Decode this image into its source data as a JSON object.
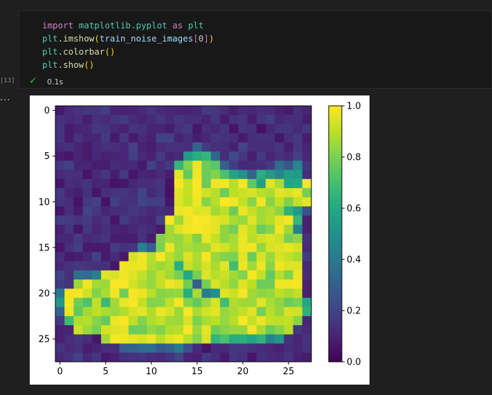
{
  "code_cell": {
    "execution_count": "[13]",
    "status_icon": "check-icon",
    "duration": "0.1s",
    "lines": [
      [
        {
          "t": "import",
          "c": "kw"
        },
        {
          "t": " "
        },
        {
          "t": "matplotlib.pyplot",
          "c": "mod"
        },
        {
          "t": " "
        },
        {
          "t": "as",
          "c": "kw"
        },
        {
          "t": " "
        },
        {
          "t": "plt",
          "c": "mod"
        }
      ],
      [
        {
          "t": "plt",
          "c": "mod"
        },
        {
          "t": "."
        },
        {
          "t": "imshow",
          "c": "fn"
        },
        {
          "t": "(",
          "c": "br1"
        },
        {
          "t": "train_noise_images",
          "c": "var"
        },
        {
          "t": "[",
          "c": "br2"
        },
        {
          "t": "0",
          "c": "num"
        },
        {
          "t": "]",
          "c": "br2"
        },
        {
          "t": ")",
          "c": "br1"
        }
      ],
      [
        {
          "t": "plt",
          "c": "mod"
        },
        {
          "t": "."
        },
        {
          "t": "colorbar",
          "c": "fn"
        },
        {
          "t": "()",
          "c": "br1"
        }
      ],
      [
        {
          "t": "plt",
          "c": "mod"
        },
        {
          "t": "."
        },
        {
          "t": "show",
          "c": "fn"
        },
        {
          "t": "()",
          "c": "br1"
        }
      ]
    ]
  },
  "output": {
    "ellipsis": "..."
  },
  "chart_data": {
    "type": "heatmap",
    "title": "",
    "xlabel": "",
    "ylabel": "",
    "x_ticks": [
      0,
      5,
      10,
      15,
      20,
      25
    ],
    "y_ticks": [
      0,
      5,
      10,
      15,
      20,
      25
    ],
    "xlim": [
      -0.5,
      27.5
    ],
    "ylim": [
      27.5,
      -0.5
    ],
    "colormap": "viridis",
    "colorbar": {
      "range": [
        0.0,
        1.0
      ],
      "ticks": [
        "0.0",
        "0.2",
        "0.4",
        "0.6",
        "0.8",
        "1.0"
      ]
    },
    "grid": false,
    "rows": [
      "0.07 0.12 0.14 0.16 0.15 0.18 0.10 0.09 0.10 0.12 0.15 0.12 0.11 0.10 0.09 0.11 0.17 0.16 0.13 0.08 0.12 0.11 0.13 0.12 0.09 0.07 0.13 0.10",
      "0.14 0.12 0.13 0.08 0.14 0.12 0.15 0.17 0.12 0.10 0.12 0.15 0.12 0.15 0.13 0.13 0.10 0.15 0.08 0.14 0.16 0.08 0.15 0.18 0.11 0.13 0.13 0.08",
      "0.15 0.07 0.10 0.11 0.16 0.15 0.11 0.09 0.15 0.14 0.10 0.10 0.08 0.14 0.17 0.06 0.13 0.11 0.15 0.05 0.15 0.14 0.04 0.11 0.15 0.15 0.12 0.16",
      "0.15 0.07 0.14 0.10 0.11 0.17 0.07 0.16 0.07 0.12 0.09 0.19 0.19 0.10 0.13 0.08 0.11 0.15 0.14 0.13 0.07 0.13 0.14 0.14 0.06 0.13 0.17 0.08",
      "0.12 0.14 0.10 0.07 0.12 0.14 0.13 0.11 0.19 0.09 0.08 0.12 0.14 0.14 0.13 0.32 0.17 0.13 0.13 0.09 0.20 0.13 0.13 0.13 0.15 0.08 0.16 0.10",
      "0.08 0.06 0.10 0.07 0.11 0.09 0.10 0.11 0.18 0.12 0.09 0.17 0.10 0.12 0.55 0.62 0.65 0.33 0.13 0.22 0.16 0.08 0.17 0.10 0.14 0.12 0.19 0.11",
      "0.16 0.19 0.10 0.10 0.08 0.08 0.13 0.11 0.12 0.07 0.19 0.12 0.17 0.66 0.81 0.97 0.77 0.74 0.30 0.18 0.11 0.12 0.13 0.17 0.35 0.27 0.45 0.15",
      "0.12 0.14 0.13 0.05 0.12 0.16 0.08 0.17 0.06 0.10 0.09 0.12 0.08 0.96 0.76 0.98 0.77 0.81 0.71 0.58 0.50 0.31 0.62 0.54 0.46 0.56 0.54 0.13",
      "0.06 0.13 0.12 0.15 0.10 0.10 0.05 0.06 0.11 0.13 0.13 0.15 0.05 0.99 0.91 1.00 0.77 0.98 0.99 0.89 0.99 0.75 0.56 0.95 0.87 0.59 0.60 0.99",
      "0.16 0.10 0.08 0.14 0.06 0.13 0.15 0.16 0.13 0.20 0.11 0.15 0.04 0.95 0.91 0.99 0.93 0.89 0.78 0.90 0.92 0.94 0.89 0.87 0.96 0.94 0.97 0.79",
      "0.15 0.13 0.05 0.17 0.19 0.05 0.19 0.14 0.14 0.20 0.18 0.18 0.06 0.95 0.90 0.97 0.82 0.89 1.00 0.98 0.91 0.82 0.98 0.82 0.91 0.81 0.91 0.96",
      "0.06 0.13 0.07 0.20 0.16 0.10 0.13 0.13 0.16 0.14 0.11 0.13 0.11 0.97 0.99 0.95 0.96 0.86 0.90 0.78 0.97 0.91 0.86 0.88 0.83 0.64 0.54 0.25",
      "0.18 0.17 0.15 0.17 0.12 0.15 0.06 0.17 0.13 0.11 0.10 0.19 0.99 0.86 0.97 1.00 0.99 0.96 0.94 0.87 0.84 0.95 0.86 0.89 0.96 0.99 0.66 0.09",
      "0.09 0.15 0.06 0.16 0.10 0.13 0.10 0.09 0.11 0.14 0.12 0.07 0.86 0.95 0.98 0.99 0.98 0.96 0.83 0.79 0.96 0.90 0.77 0.82 0.98 0.86 0.43 0.09",
      "0.11 0.11 0.17 0.11 0.13 0.15 0.08 0.08 0.08 0.14 0.08 0.81 0.86 0.84 0.90 0.81 0.97 0.91 0.83 0.87 0.97 0.89 0.93 0.95 0.92 0.79 0.83 0.14",
      "0.06 0.14 0.18 0.07 0.07 0.07 0.18 0.14 0.16 0.43 0.30 0.80 0.97 0.85 0.87 0.85 0.86 0.96 0.93 0.88 0.97 0.98 0.84 0.94 0.95 0.97 0.94 0.12",
      "0.13 0.07 0.08 0.11 0.19 0.07 0.12 0.07 0.94 0.98 0.89 0.99 0.89 0.84 0.95 0.88 0.99 0.85 0.81 0.80 0.96 0.77 0.94 0.85 0.94 0.91 0.87 0.17",
      "0.11 0.14 0.16 0.15 0.14 0.13 0.06 0.98 0.97 0.98 0.88 0.85 0.88 0.63 0.91 0.87 0.94 0.87 0.96 0.69 0.97 0.86 0.97 0.82 0.98 0.95 0.95 0.11",
      "0.19 0.13 0.37 0.35 0.43 0.95 0.94 0.98 0.95 0.91 0.84 0.91 0.86 0.79 0.60 0.79 0.95 0.89 0.92 0.86 0.81 0.99 0.91 0.76 0.89 0.81 0.97 0.12",
      "0.17 0.14 0.85 0.98 0.86 0.85 0.99 0.99 0.93 0.88 0.84 0.91 0.98 0.95 0.78 0.29 0.79 0.94 0.89 0.83 0.95 0.90 0.77 0.78 0.98 0.98 0.99 0.09",
      "0.40 0.98 0.99 0.93 0.81 0.87 0.98 0.78 0.99 0.97 0.89 0.82 0.83 0.84 0.62 0.87 0.41 0.49 0.95 0.92 0.99 0.86 0.83 0.84 0.90 0.87 0.91 0.09",
      "0.53 0.99 0.78 0.72 0.91 0.67 0.86 0.97 0.99 0.91 0.81 0.82 0.90 0.99 0.82 0.76 0.85 0.94 0.69 0.88 0.86 0.85 0.96 0.87 0.83 0.77 0.80 0.60",
      "0.32 0.97 0.75 0.86 0.90 0.87 0.85 0.88 0.94 0.96 0.88 0.97 0.94 0.85 0.99 0.87 0.93 0.96 0.84 0.87 0.91 0.95 0.79 0.89 0.84 0.94 0.93 0.64",
      "0.17 0.68 0.88 0.89 0.82 0.76 0.97 0.99 0.90 0.81 0.88 0.91 0.86 0.85 0.94 0.80 0.87 0.90 0.84 0.89 0.99 0.91 0.97 0.91 0.90 0.91 0.82 0.11",
      "0.09 0.10 0.92 0.85 0.79 0.94 0.95 0.96 0.77 0.78 0.84 0.81 0.88 0.89 0.99 0.85 0.96 0.78 0.82 0.84 0.84 0.98 0.87 0.77 0.82 0.89 0.16 0.12",
      "0.09 0.13 0.15 0.13 0.06 0.86 0.99 0.98 0.96 0.94 0.97 0.89 0.95 0.97 0.89 0.81 0.94 0.65 0.71 0.62 0.63 0.59 0.64 0.44 0.52 0.14 0.10 0.15",
      "0.15 0.12 0.14 0.08 0.10 0.13 0.13 0.30 0.32 0.35 0.36 0.28 0.31 0.40 0.24 0.12 0.05 0.12 0.12 0.16 0.16 0.14 0.12 0.11 0.09 0.13 0.11 0.14",
      "0.11 0.14 0.19 0.11 0.16 0.07 0.09 0.13 0.14 0.15 0.13 0.12 0.15 0.20 0.10 0.09 0.17 0.13 0.07 0.16 0.14 0.06 0.14 0.12 0.11 0.15 0.09 0.08"
    ]
  }
}
